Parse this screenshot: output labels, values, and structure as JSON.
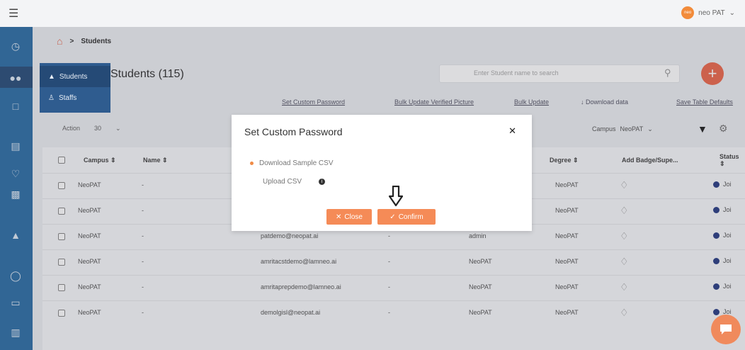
{
  "user": {
    "avatar_text": "neo",
    "name": "neo PAT"
  },
  "breadcrumb": {
    "current": "Students"
  },
  "submenu": {
    "students": "Students",
    "staffs": "Staffs"
  },
  "page": {
    "title": "Students (115)"
  },
  "search": {
    "placeholder": "Enter Student name to search"
  },
  "actions": {
    "set_custom_password": "Set Custom Password",
    "bulk_update_verified_picture": "Bulk Update Verified Picture",
    "bulk_update": "Bulk Update",
    "download_data": "Download data",
    "save_table_defaults": "Save Table Defaults"
  },
  "filters": {
    "action": "Action",
    "page_size": "30",
    "campus_label": "Campus",
    "campus_value": "NeoPAT"
  },
  "table": {
    "headers": {
      "campus": "Campus ⇕",
      "name": "Name ⇕",
      "degree": "Degree ⇕",
      "add_badge": "Add Badge/Supe...",
      "status": "Status ⇕"
    },
    "rows": [
      {
        "campus": "NeoPAT",
        "name": "-",
        "email": "",
        "col4": "",
        "col5": "",
        "degree": "NeoPAT",
        "status": "Joi"
      },
      {
        "campus": "NeoPAT",
        "name": "-",
        "email": "",
        "col4": "",
        "col5": "",
        "degree": "NeoPAT",
        "status": "Joi"
      },
      {
        "campus": "NeoPAT",
        "name": "-",
        "email": "patdemo@neopat.ai",
        "col4": "-",
        "col5": "admin",
        "degree": "NeoPAT",
        "status": "Joi"
      },
      {
        "campus": "NeoPAT",
        "name": "-",
        "email": "amritacstdemo@lamneo.ai",
        "col4": "-",
        "col5": "NeoPAT",
        "degree": "NeoPAT",
        "status": "Joi"
      },
      {
        "campus": "NeoPAT",
        "name": "-",
        "email": "amritaprepdemo@lamneo.ai",
        "col4": "-",
        "col5": "NeoPAT",
        "degree": "NeoPAT",
        "status": "Joi"
      },
      {
        "campus": "NeoPAT",
        "name": "-",
        "email": "demolgisl@neopat.ai",
        "col4": "-",
        "col5": "NeoPAT",
        "degree": "NeoPAT",
        "status": "Joi"
      }
    ]
  },
  "modal": {
    "title": "Set Custom Password",
    "download_sample": "Download Sample CSV",
    "upload_csv": "Upload CSV",
    "close_label": "Close",
    "confirm_label": "Confirm"
  },
  "colors": {
    "sidebar": "#2f6fa7",
    "accent": "#f58b57",
    "add_button": "#ec6a4e"
  },
  "icons": [
    "menu-icon",
    "dashboard-icon",
    "users-icon",
    "home-icon",
    "search-icon",
    "filter-icon",
    "gear-icon",
    "badge-icon",
    "chat-icon"
  ]
}
